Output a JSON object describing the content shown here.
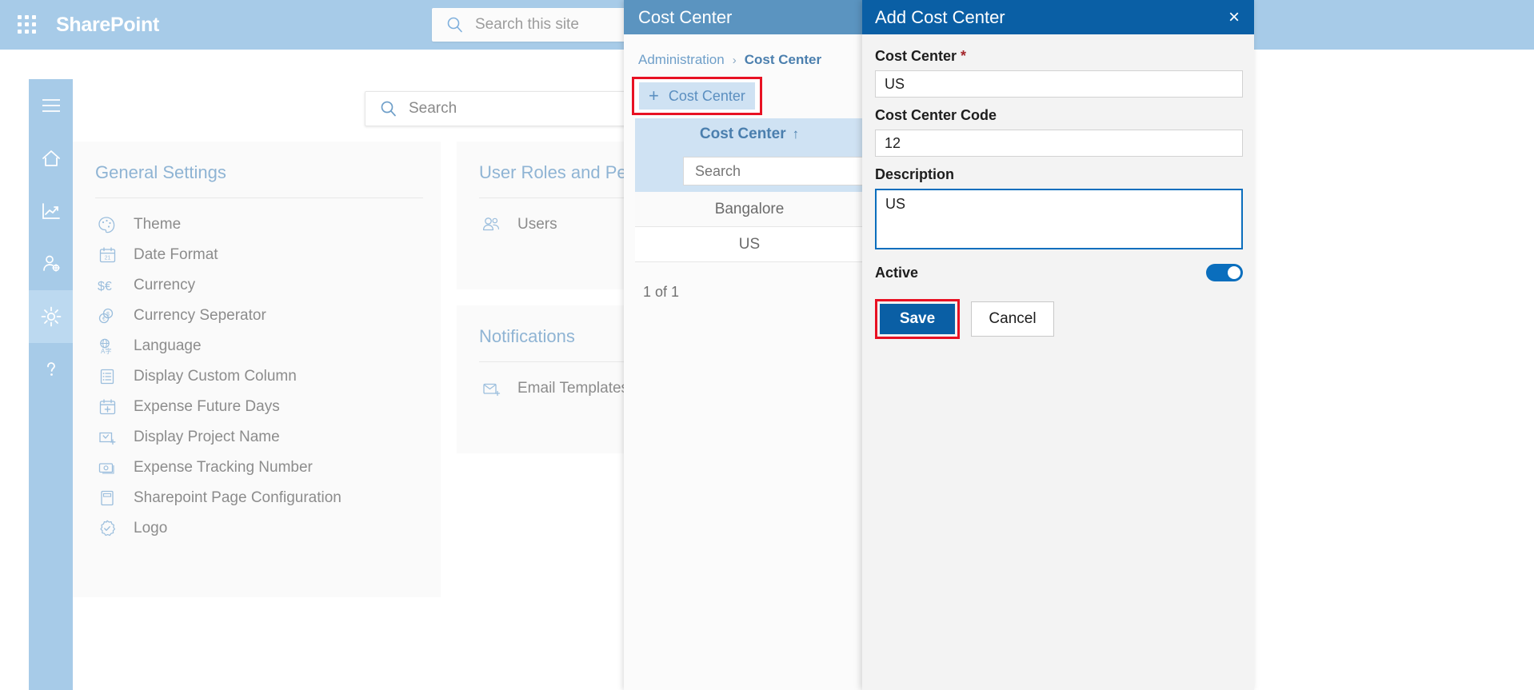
{
  "suitebar": {
    "app_launcher": "waffle-icon",
    "brand": "SharePoint",
    "search_placeholder": "Search this site"
  },
  "rail": {
    "items": [
      {
        "name": "hamburger-icon",
        "label": "Menu",
        "active": false
      },
      {
        "name": "home-icon",
        "label": "Home",
        "active": false
      },
      {
        "name": "chart-icon",
        "label": "Analytics",
        "active": false
      },
      {
        "name": "user-settings-icon",
        "label": "User Settings",
        "active": false
      },
      {
        "name": "gear-icon",
        "label": "Settings",
        "active": true
      },
      {
        "name": "help-icon",
        "label": "Help",
        "active": false
      }
    ]
  },
  "page": {
    "search_placeholder": "Search"
  },
  "cards": {
    "general": {
      "title": "General Settings",
      "items": [
        {
          "icon": "palette-icon",
          "label": "Theme"
        },
        {
          "icon": "calendar-icon",
          "label": "Date Format"
        },
        {
          "icon": "currency-icon",
          "label": "Currency"
        },
        {
          "icon": "coins-icon",
          "label": "Currency Seperator"
        },
        {
          "icon": "language-icon",
          "label": "Language"
        },
        {
          "icon": "list-icon",
          "label": "Display Custom Column"
        },
        {
          "icon": "calendar-plus-icon",
          "label": "Expense Future Days"
        },
        {
          "icon": "folder-check-icon",
          "label": "Display Project Name"
        },
        {
          "icon": "money-icon",
          "label": "Expense Tracking Number"
        },
        {
          "icon": "page-icon",
          "label": "Sharepoint Page Configuration"
        },
        {
          "icon": "badge-icon",
          "label": "Logo"
        }
      ]
    },
    "roles": {
      "title": "User Roles and Permissions",
      "items": [
        {
          "icon": "people-icon",
          "label": "Users"
        }
      ]
    },
    "notifications": {
      "title": "Notifications",
      "items": [
        {
          "icon": "mail-template-icon",
          "label": "Email Templates"
        }
      ]
    }
  },
  "cost_center_panel": {
    "header": "Cost Center",
    "breadcrumb": {
      "parent": "Administration",
      "separator": "›",
      "current": "Cost Center"
    },
    "add_button": {
      "plus": "+",
      "label": "Cost Center"
    },
    "column_header": {
      "label": "Cost Center",
      "sort": "↑"
    },
    "search_placeholder": "Search",
    "rows": [
      {
        "label": "Bangalore"
      },
      {
        "label": "US"
      }
    ],
    "pager": "1 of 1"
  },
  "form_panel": {
    "header": "Add Cost Center",
    "close": "×",
    "fields": [
      {
        "label": "Cost Center",
        "required": true,
        "value": "US"
      },
      {
        "label": "Cost Center Code",
        "required": false,
        "value": "12"
      }
    ],
    "description": {
      "label": "Description",
      "value": "US"
    },
    "active": {
      "label": "Active",
      "on": true
    },
    "buttons": {
      "save": "Save",
      "cancel": "Cancel"
    }
  },
  "colors": {
    "suitebar": "#a7cbe8",
    "panel_header": "#5b94c0",
    "form_header": "#0a5fa5",
    "accent_blue": "#0a6ebd",
    "highlight_red": "#e81123",
    "row_selected": "#cfe2f3"
  }
}
